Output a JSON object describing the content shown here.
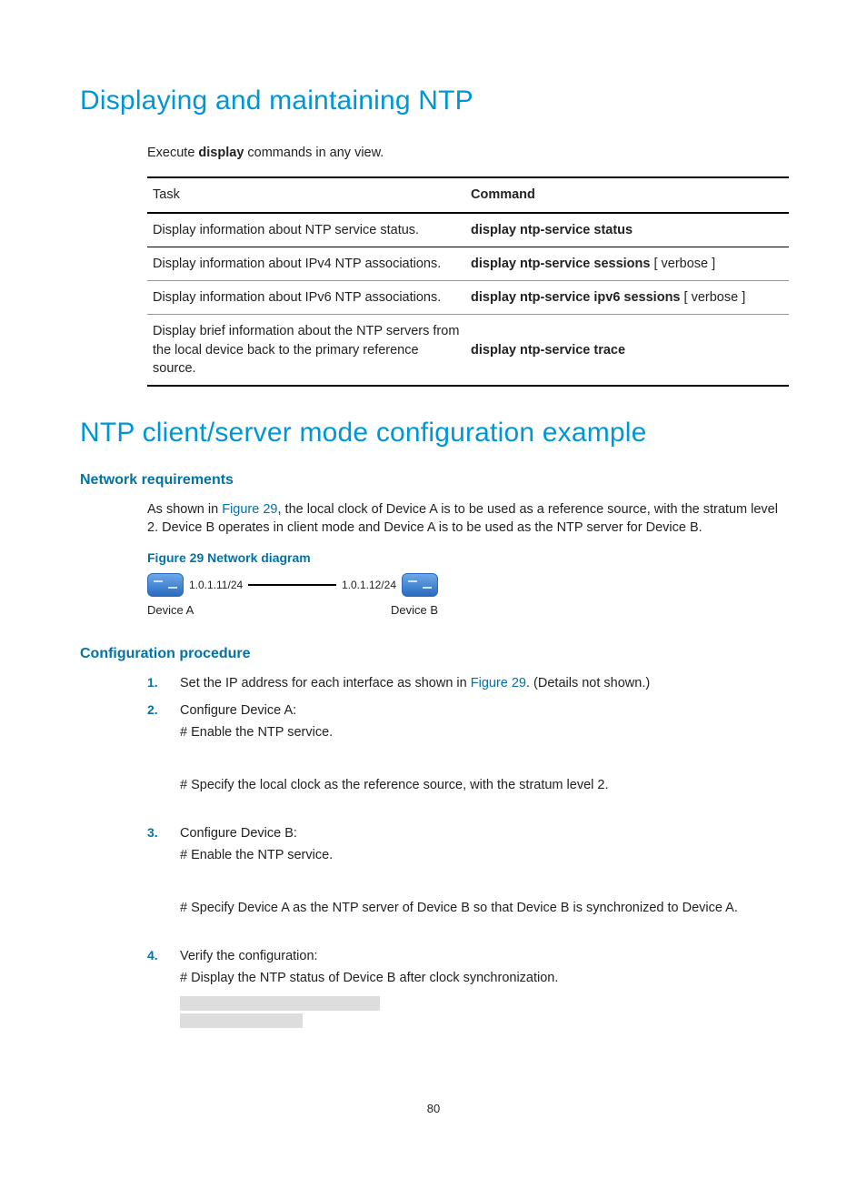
{
  "h1a": "Displaying and maintaining NTP",
  "intro_pre": "Execute ",
  "intro_bold": "display",
  "intro_post": " commands in any view.",
  "table": {
    "head_task": "Task",
    "head_cmd": "Command",
    "rows": [
      {
        "task": "Display information about NTP service status.",
        "cmd_bold": "display ntp-service status",
        "cmd_opt": ""
      },
      {
        "task": "Display information about IPv4 NTP associations.",
        "cmd_bold": "display ntp-service sessions",
        "cmd_opt": " [ verbose ]"
      },
      {
        "task": "Display information about IPv6 NTP associations.",
        "cmd_bold": "display ntp-service ipv6 sessions",
        "cmd_opt": " [ verbose ]"
      },
      {
        "task": "Display brief information about the NTP servers from the local device back to the primary reference source.",
        "cmd_bold": "display ntp-service trace",
        "cmd_opt": ""
      }
    ]
  },
  "h1b": "NTP client/server mode configuration example",
  "netreq": {
    "heading": "Network requirements",
    "p_pre": "As shown in ",
    "p_link": "Figure 29",
    "p_post": ", the local clock of Device A is to be used as a reference source, with the stratum level 2. Device B operates in client mode and Device A is to be used as the NTP server for Device B."
  },
  "fig": {
    "caption": "Figure 29 Network diagram",
    "ip_a": "1.0.1.11/24",
    "ip_b": "1.0.1.12/24",
    "dev_a": "Device A",
    "dev_b": "Device B"
  },
  "cfg": {
    "heading": "Configuration procedure",
    "steps": {
      "s1_pre": "Set the IP address for each interface as shown in ",
      "s1_link": "Figure 29",
      "s1_post": ". (Details not shown.)",
      "s2_head": "Configure Device A:",
      "s2_a": "# Enable the NTP service.",
      "s2_b": "# Specify the local clock as the reference source, with the stratum level 2.",
      "s3_head": "Configure Device B:",
      "s3_a": "# Enable the NTP service.",
      "s3_b": "# Specify Device A as the NTP server of Device B so that Device B is synchronized to Device A.",
      "s4_head": "Verify the configuration:",
      "s4_a": "# Display the NTP status of Device B after clock synchronization."
    }
  },
  "page_number": "80"
}
